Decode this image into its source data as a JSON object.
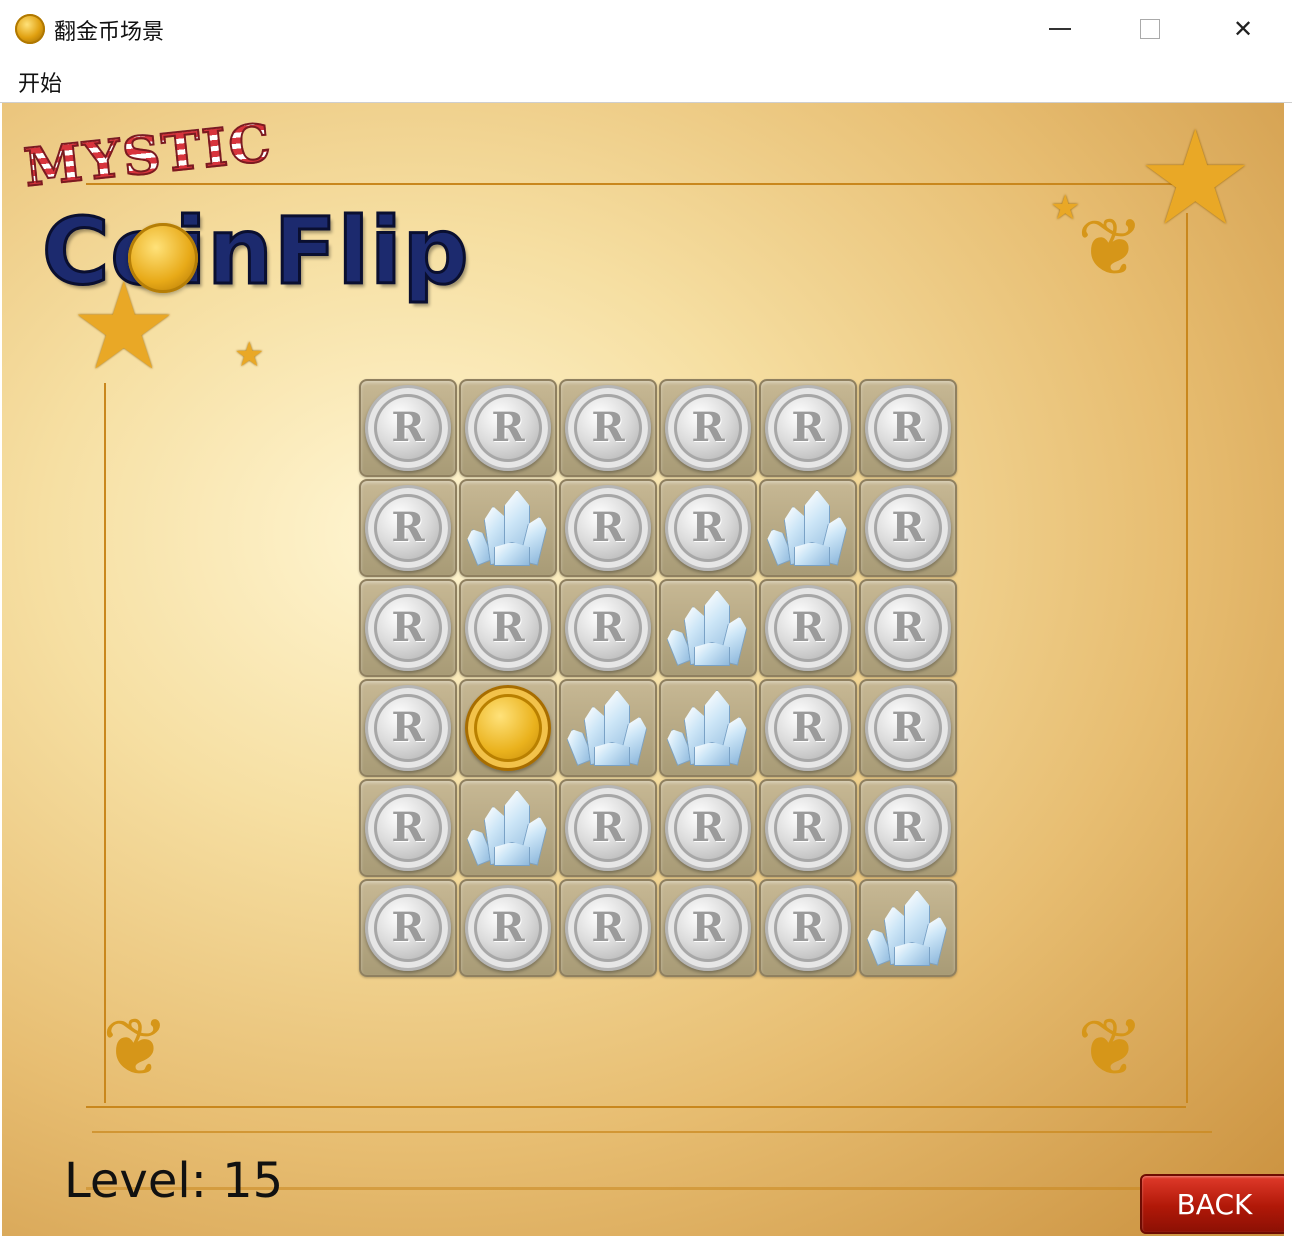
{
  "window": {
    "title": "翻金币场景",
    "minimize_icon": "minimize-icon",
    "maximize_icon": "maximize-icon",
    "close_icon": "close-icon",
    "close_glyph": "✕"
  },
  "menu": {
    "items": [
      {
        "label": "开始"
      }
    ]
  },
  "logo": {
    "line1": "MYSTIC",
    "line2": "CoinFlip"
  },
  "board": {
    "rows": 6,
    "cols": 6,
    "cells": [
      [
        "silver",
        "silver",
        "silver",
        "silver",
        "silver",
        "silver"
      ],
      [
        "silver",
        "crystal",
        "silver",
        "silver",
        "crystal",
        "silver"
      ],
      [
        "silver",
        "silver",
        "silver",
        "crystal",
        "silver",
        "silver"
      ],
      [
        "silver",
        "gold",
        "crystal",
        "crystal",
        "silver",
        "silver"
      ],
      [
        "silver",
        "crystal",
        "silver",
        "silver",
        "silver",
        "silver"
      ],
      [
        "silver",
        "silver",
        "silver",
        "silver",
        "silver",
        "crystal"
      ]
    ]
  },
  "level": {
    "text": "Level: 15"
  },
  "back_button": {
    "label": "BACK"
  },
  "colors": {
    "back_button": "#b01808",
    "background_center": "#fff6d3",
    "background_edge": "#c98f3c",
    "frame_line": "#c9871d"
  }
}
